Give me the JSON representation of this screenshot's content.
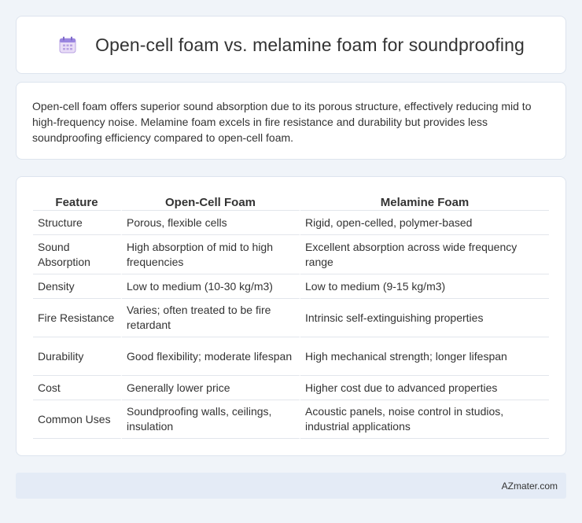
{
  "header": {
    "title": "Open-cell foam vs. melamine foam for soundproofing",
    "icon": "calendar-icon"
  },
  "summary": {
    "text": "Open-cell foam offers superior sound absorption due to its porous structure, effectively reducing mid to high-frequency noise. Melamine foam excels in fire resistance and durability but provides less soundproofing efficiency compared to open-cell foam."
  },
  "table": {
    "headers": [
      "Feature",
      "Open-Cell Foam",
      "Melamine Foam"
    ],
    "rows": [
      [
        "Structure",
        "Porous, flexible cells",
        "Rigid, open-celled, polymer-based"
      ],
      [
        "Sound Absorption",
        "High absorption of mid to high frequencies",
        "Excellent absorption across wide frequency range"
      ],
      [
        "Density",
        "Low to medium (10-30 kg/m3)",
        "Low to medium (9-15 kg/m3)"
      ],
      [
        "Fire Resistance",
        "Varies; often treated to be fire retardant",
        "Intrinsic self-extinguishing properties"
      ],
      [
        "Durability",
        "Good flexibility; moderate lifespan",
        "High mechanical strength; longer lifespan"
      ],
      [
        "Cost",
        "Generally lower price",
        "Higher cost due to advanced properties"
      ],
      [
        "Common Uses",
        "Soundproofing walls, ceilings, insulation",
        "Acoustic panels, noise control in studios, industrial applications"
      ]
    ]
  },
  "footer": {
    "text": "AZmater.com"
  }
}
